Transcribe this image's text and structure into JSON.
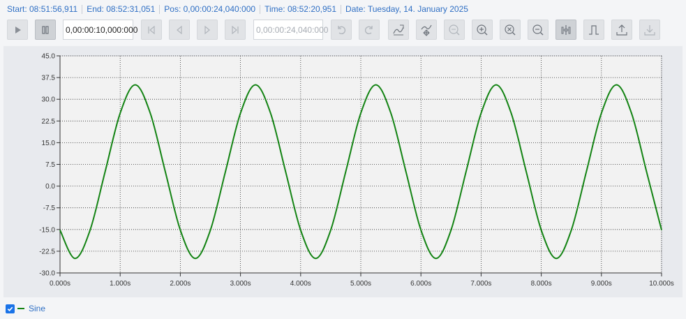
{
  "status": {
    "start": "Start: 08:51:56,911",
    "end": "End: 08:52:31,051",
    "pos": "Pos: 0,00:00:24,040:000",
    "time": "Time: 08:52:20,951",
    "date": "Date: Tuesday, 14. January 2025"
  },
  "toolbar": {
    "interval_value": "0,00:00:10,000:000",
    "position_value": "0,00:00:24,040:000"
  },
  "colors": {
    "accent": "#2f6fc4",
    "series": "#138313",
    "checkbox": "#1a73e8"
  },
  "legend": {
    "checked": true,
    "label": "Sine"
  },
  "chart_data": {
    "type": "line",
    "title": "",
    "xlabel": "",
    "ylabel": "",
    "xlim": [
      0,
      10
    ],
    "ylim": [
      -30,
      45
    ],
    "x_ticks": [
      "0.000s",
      "1.000s",
      "2.000s",
      "3.000s",
      "4.000s",
      "5.000s",
      "6.000s",
      "7.000s",
      "8.000s",
      "9.000s",
      "10.000s"
    ],
    "y_ticks": [
      "45.0",
      "37.5",
      "30.0",
      "22.5",
      "15.0",
      "7.5",
      "0.0",
      "-7.5",
      "-15.0",
      "-22.5",
      "-30.0"
    ],
    "grid": true,
    "series": [
      {
        "name": "Sine",
        "x": [
          0,
          0.25,
          0.5,
          0.75,
          1.0,
          1.25,
          1.5,
          1.75,
          2.0,
          2.25,
          2.5,
          2.75,
          3.0,
          3.25,
          3.5,
          3.75,
          4.0,
          4.25,
          4.5,
          4.75,
          5.0,
          5.25,
          5.5,
          5.75,
          6.0,
          6.25,
          6.5,
          6.75,
          7.0,
          7.25,
          7.5,
          7.75,
          8.0,
          8.25,
          8.5,
          8.75,
          9.0,
          9.25,
          9.5,
          9.75,
          10.0
        ],
        "values": [
          -15.2,
          -25.0,
          -15.2,
          5.0,
          25.2,
          35.0,
          25.2,
          5.0,
          -15.2,
          -25.0,
          -15.2,
          5.0,
          25.2,
          35.0,
          25.2,
          5.0,
          -15.2,
          -25.0,
          -15.2,
          5.0,
          25.2,
          35.0,
          25.2,
          5.0,
          -15.2,
          -25.0,
          -15.2,
          5.0,
          25.2,
          35.0,
          25.2,
          5.0,
          -15.2,
          -25.0,
          -15.2,
          5.0,
          25.2,
          35.0,
          25.2,
          5.0,
          -15.2
        ]
      }
    ]
  }
}
